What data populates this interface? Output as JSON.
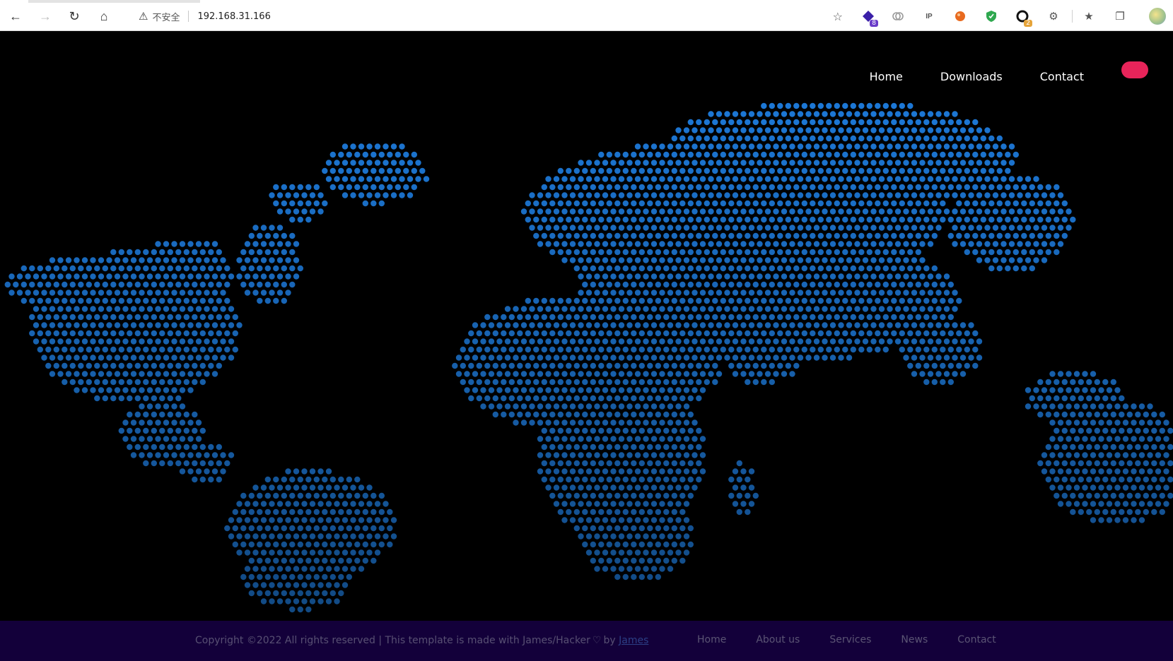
{
  "browser": {
    "security_label": "不安全",
    "url": "192.168.31.166",
    "extensions": [
      {
        "name": "extension-1",
        "badge": "8",
        "badge_color": "#6a3cc9"
      },
      {
        "name": "extension-2"
      },
      {
        "name": "ip-extension",
        "label": "IP"
      },
      {
        "name": "extension-4"
      },
      {
        "name": "shield-extension"
      },
      {
        "name": "extension-6",
        "badge": "2",
        "badge_color": "#e6a43a"
      }
    ]
  },
  "nav": {
    "home": "Home",
    "downloads": "Downloads",
    "contact": "Contact",
    "pill_color": "#e8245a"
  },
  "hero": {
    "map_dot_color": "#1e7de0",
    "background": "#000000"
  },
  "footer": {
    "copyright_text": "Copyright ©2022 All rights reserved | This template is made with James/Hacker",
    "by": "by",
    "author": "James",
    "links": [
      "Home",
      "About us",
      "Services",
      "News",
      "Contact"
    ],
    "background": "#13003a"
  }
}
